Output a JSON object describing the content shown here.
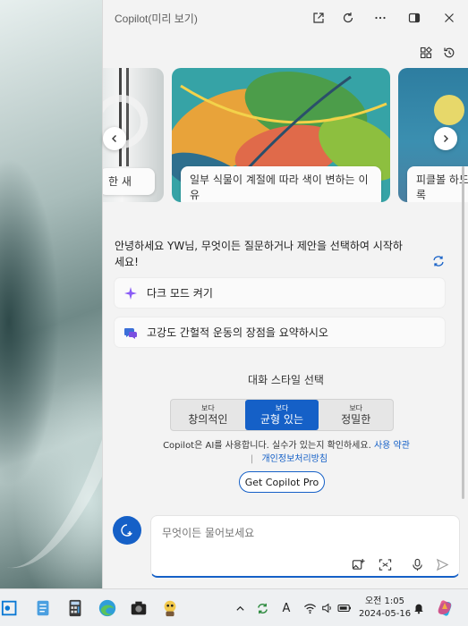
{
  "window": {
    "title": "Copilot(미리 보기)"
  },
  "carousel": {
    "cards": [
      {
        "caption": "한 새"
      },
      {
        "caption": "일부 식물이 계절에 따라 색이 변하는 이유"
      },
      {
        "caption": "피클볼 하도록"
      }
    ]
  },
  "greeting": "안녕하세요 YW님, 무엇이든 질문하거나 제안을 선택하여 시작하세요!",
  "suggestions": [
    {
      "label": "다크 모드 켜기",
      "icon": "sparkle-icon"
    },
    {
      "label": "고강도 간헐적 운동의 장점을 요약하시오",
      "icon": "chat-bubbles-icon"
    }
  ],
  "conversation_style": {
    "title": "대화 스타일 선택",
    "options": [
      {
        "small": "보다",
        "label": "창의적인"
      },
      {
        "small": "보다",
        "label": "균형 있는"
      },
      {
        "small": "보다",
        "label": "정밀한"
      }
    ],
    "selected": "균형 있는"
  },
  "disclaimer": {
    "text": "Copilot은 AI를 사용합니다. 실수가 있는지 확인하세요.",
    "terms_link": "사용 약관",
    "privacy_link": "개인정보처리방침"
  },
  "pro_button": "Get Copilot Pro",
  "input": {
    "placeholder": "무엇이든 물어보세요"
  },
  "taskbar": {
    "time": "오전 1:05",
    "date": "2024-05-16",
    "ime": "A"
  },
  "colors": {
    "accent": "#1560c7",
    "panel_bg": "#f3f3f3"
  }
}
